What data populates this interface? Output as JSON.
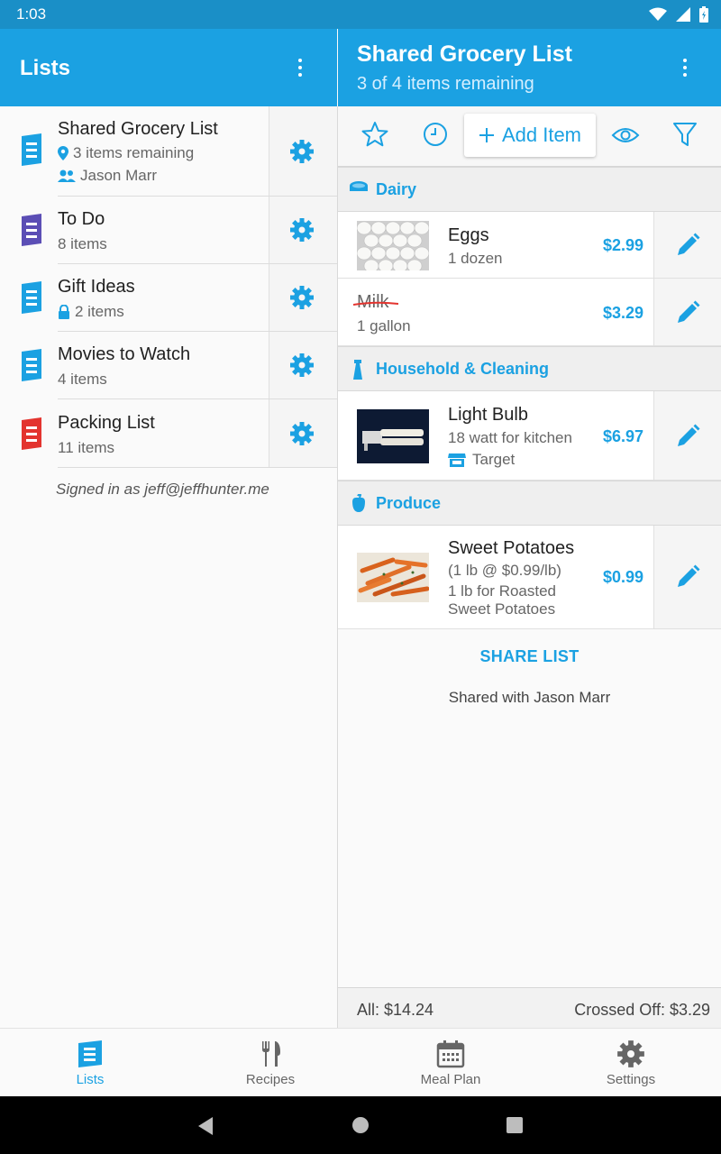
{
  "status_bar": {
    "time": "1:03"
  },
  "left_panel": {
    "title": "Lists",
    "lists": [
      {
        "name": "Shared Grocery List",
        "meta": "3 items remaining",
        "meta_icon": "location-pin-icon",
        "shared_with": "Jason Marr",
        "color": "#1ba1e2"
      },
      {
        "name": "To Do",
        "meta": "8 items",
        "color": "#5b4eb5"
      },
      {
        "name": "Gift Ideas",
        "meta": "2 items",
        "meta_icon": "lock-icon",
        "color": "#1ba1e2"
      },
      {
        "name": "Movies to Watch",
        "meta": "4 items",
        "color": "#1ba1e2"
      },
      {
        "name": "Packing List",
        "meta": "11 items",
        "color": "#e3342f"
      }
    ],
    "signed_in": "Signed in as jeff@jeffhunter.me"
  },
  "right_panel": {
    "title": "Shared Grocery List",
    "subtitle": "3 of 4 items remaining",
    "toolbar": {
      "add_item": "Add Item"
    },
    "categories": [
      {
        "name": "Dairy",
        "icon": "dairy-icon",
        "items": [
          {
            "name": "Eggs",
            "detail": "1 dozen",
            "price": "$2.99",
            "crossed": false,
            "image": "eggs"
          },
          {
            "name": "Milk",
            "detail": "1 gallon",
            "price": "$3.29",
            "crossed": true
          }
        ]
      },
      {
        "name": "Household & Cleaning",
        "icon": "spray-bottle-icon",
        "items": [
          {
            "name": "Light Bulb",
            "detail": "18 watt for kitchen",
            "store": "Target",
            "price": "$6.97",
            "crossed": false,
            "image": "light-bulb"
          }
        ]
      },
      {
        "name": "Produce",
        "icon": "pepper-icon",
        "items": [
          {
            "name": "Sweet Potatoes",
            "detail1": "(1 lb @ $0.99/lb)",
            "detail2": "1 lb for Roasted",
            "detail3": "Sweet Potatoes",
            "price": "$0.99",
            "crossed": false,
            "image": "sweet-potatoes"
          }
        ]
      }
    ],
    "share_label": "SHARE LIST",
    "shared_with": "Shared with Jason Marr",
    "totals": {
      "all": "All: $14.24",
      "crossed_off": "Crossed Off: $3.29"
    }
  },
  "bottom_nav": [
    {
      "label": "Lists",
      "icon": "lists-icon",
      "active": true
    },
    {
      "label": "Recipes",
      "icon": "fork-knife-icon",
      "active": false
    },
    {
      "label": "Meal Plan",
      "icon": "calendar-icon",
      "active": false
    },
    {
      "label": "Settings",
      "icon": "gear-icon",
      "active": false
    }
  ],
  "colors": {
    "accent": "#1ba1e2",
    "status_bar": "#1a8fc7",
    "todo": "#5b4eb5",
    "packing": "#e3342f"
  }
}
